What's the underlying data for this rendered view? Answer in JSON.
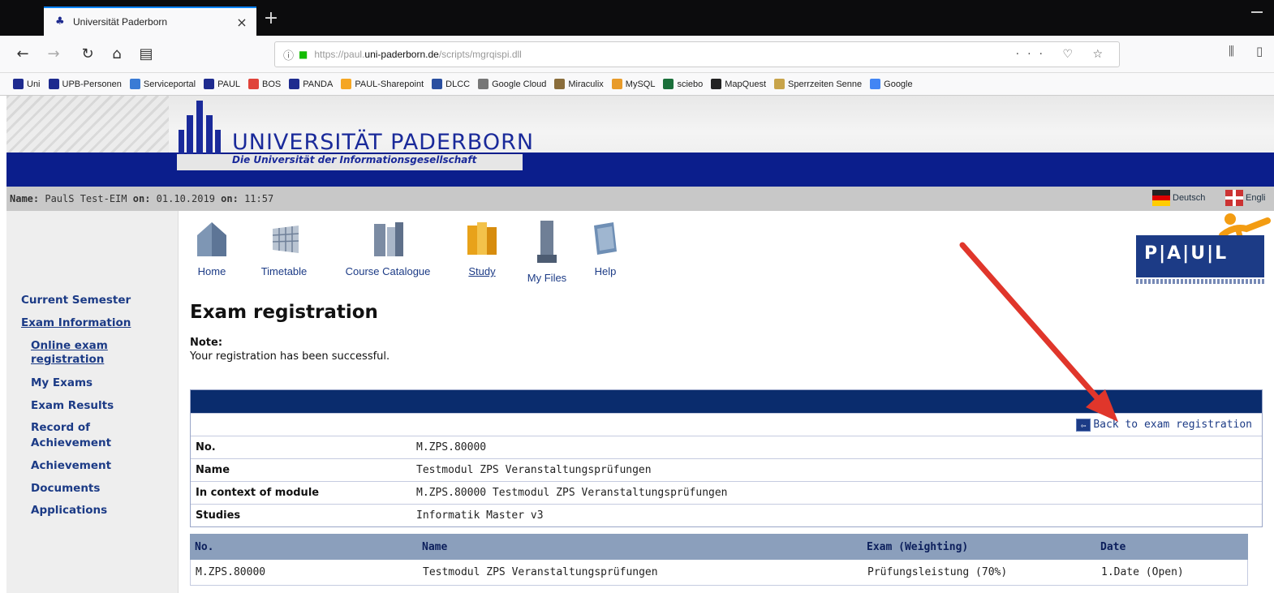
{
  "browser": {
    "tab_title": "Universität Paderborn",
    "tab_close": "×",
    "new_tab": "+",
    "url_prefix": "https://paul.",
    "url_host": "uni-paderborn.de",
    "url_path": "/scripts/mgrqispi.dll",
    "url_actions": "··· ♡ ☆",
    "bookmarks": [
      {
        "label": "Uni",
        "color": "#1e2b8f"
      },
      {
        "label": "UPB-Personen",
        "color": "#1e2b8f"
      },
      {
        "label": "Serviceportal",
        "color": "#3a7bd5"
      },
      {
        "label": "PAUL",
        "color": "#1e2b8f"
      },
      {
        "label": "BOS",
        "color": "#e0433a"
      },
      {
        "label": "PANDA",
        "color": "#1e2b8f"
      },
      {
        "label": "PAUL-Sharepoint",
        "color": "#f5a623"
      },
      {
        "label": "DLCC",
        "color": "#2a4fa0"
      },
      {
        "label": "Google Cloud",
        "color": "#777777"
      },
      {
        "label": "Miraculix",
        "color": "#8a6d3b"
      },
      {
        "label": "MySQL",
        "color": "#e89b2a"
      },
      {
        "label": "sciebo",
        "color": "#1a6f3a"
      },
      {
        "label": "MapQuest",
        "color": "#222222"
      },
      {
        "label": "Sperrzeiten Senne",
        "color": "#c8a44a"
      },
      {
        "label": "Google",
        "color": "#4285f4"
      }
    ]
  },
  "header": {
    "university": "UNIVERSITÄT PADERBORN",
    "subtitle": "Die Universität der Informationsgesellschaft"
  },
  "status": {
    "name_label": "Name:",
    "name_value": "PaulS Test-EIM",
    "on_label_1": "on:",
    "date": "01.10.2019",
    "on_label_2": "on:",
    "time": "11:57",
    "lang_de": "Deutsch",
    "lang_en": "Engli"
  },
  "sidebar": {
    "items": [
      {
        "label": "Current Semester"
      },
      {
        "label": "Exam Information"
      },
      {
        "label": "Online exam registration"
      },
      {
        "label": "My Exams"
      },
      {
        "label": "Exam Results"
      },
      {
        "label": "Record of Achievement"
      },
      {
        "label": "Achievement"
      },
      {
        "label": "Documents"
      },
      {
        "label": "Applications"
      }
    ]
  },
  "nav": {
    "home": "Home",
    "timetable": "Timetable",
    "course_catalogue": "Course Catalogue",
    "study": "Study",
    "my_files": "My Files",
    "help": "Help"
  },
  "paul_logo": "P|A|U|L",
  "main": {
    "title": "Exam registration",
    "note_label": "Note:",
    "note_text": "Your registration has been successful.",
    "back_link": "Back to exam registration",
    "details": [
      {
        "label": "No.",
        "value": "M.ZPS.80000"
      },
      {
        "label": "Name",
        "value": "Testmodul ZPS Veranstaltungsprüfungen"
      },
      {
        "label": "In context of module",
        "value": "M.ZPS.80000 Testmodul ZPS Veranstaltungsprüfungen"
      },
      {
        "label": "Studies",
        "value": "Informatik Master v3"
      }
    ],
    "exam_table": {
      "headers": [
        "No.",
        "Name",
        "Exam (Weighting)",
        "Date"
      ],
      "rows": [
        [
          "M.ZPS.80000",
          "Testmodul ZPS Veranstaltungsprüfungen",
          "Prüfungsleistung (70%)",
          "1.Date (Open)"
        ]
      ]
    }
  }
}
